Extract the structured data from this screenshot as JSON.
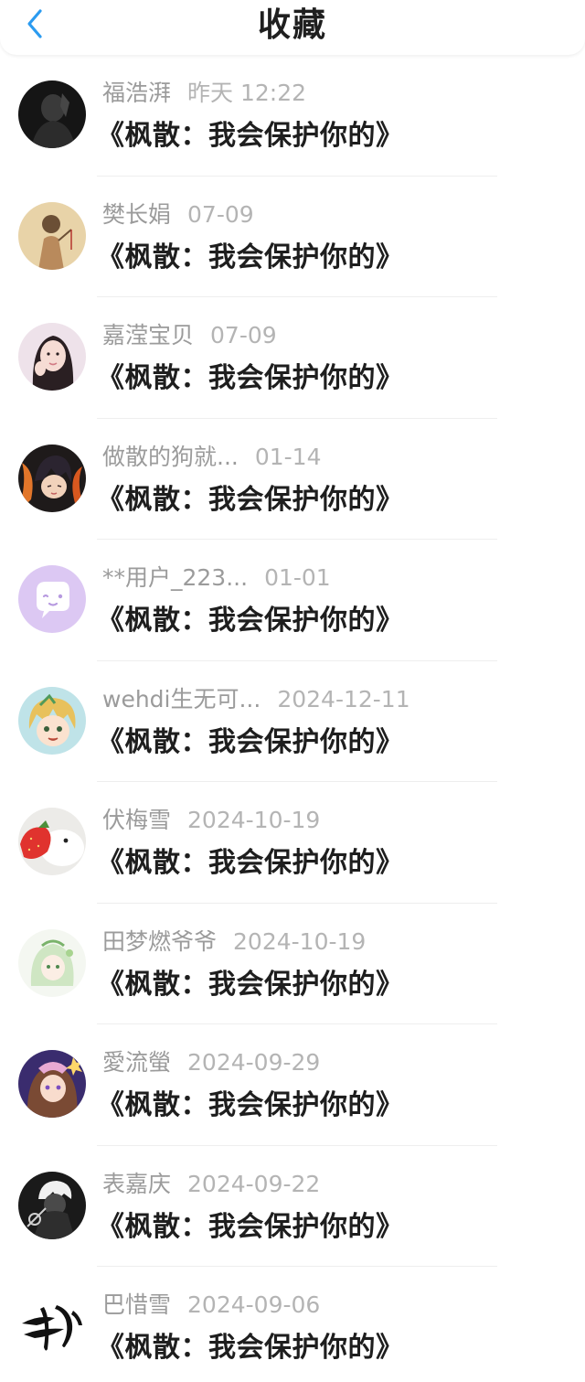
{
  "header": {
    "title": "收藏",
    "back_icon": "chevron-left-icon",
    "accent_color": "#2b9bf0"
  },
  "items": [
    {
      "username": "福浩湃",
      "date": "昨天 12:22",
      "title": "《枫散：我会保护你的》",
      "avatar_style": "dark-silhouette"
    },
    {
      "username": "樊长娟",
      "date": "07-09",
      "title": "《枫散：我会保护你的》",
      "avatar_style": "sketch-figure"
    },
    {
      "username": "嘉滢宝贝",
      "date": "07-09",
      "title": "《枫散：我会保护你的》",
      "avatar_style": "portrait-photo"
    },
    {
      "username": "做散的狗就...",
      "date": "01-14",
      "title": "《枫散：我会保护你的》",
      "avatar_style": "anime-fire"
    },
    {
      "username": "**用户_223...",
      "date": "01-01",
      "title": "《枫散：我会保护你的》",
      "avatar_style": "default-chat-bubble"
    },
    {
      "username": "wehdi生无可...",
      "date": "2024-12-11",
      "title": "《枫散：我会保护你的》",
      "avatar_style": "anime-blonde"
    },
    {
      "username": "伏梅雪",
      "date": "2024-10-19",
      "title": "《枫散：我会保护你的》",
      "avatar_style": "strawberry-bird"
    },
    {
      "username": "田梦燃爷爷",
      "date": "2024-10-19",
      "title": "《枫散：我会保护你的》",
      "avatar_style": "anime-green"
    },
    {
      "username": "愛流螢",
      "date": "2024-09-29",
      "title": "《枫散：我会保护你的》",
      "avatar_style": "anime-purple"
    },
    {
      "username": "表嘉庆",
      "date": "2024-09-22",
      "title": "《枫散：我会保护你的》",
      "avatar_style": "anime-dark-white-hair"
    },
    {
      "username": "巴惜雪",
      "date": "2024-09-06",
      "title": "《枫散：我会保护你的》",
      "avatar_style": "calligraphy-logo"
    }
  ]
}
